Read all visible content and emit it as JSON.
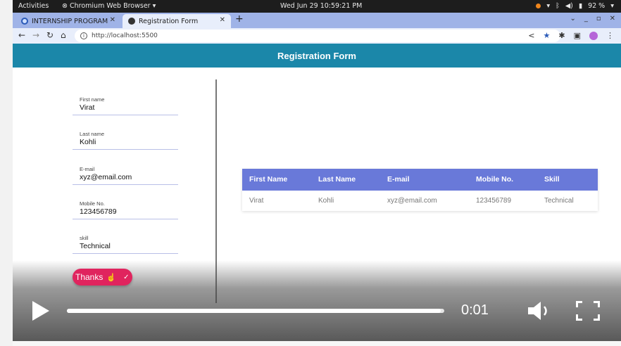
{
  "system_bar": {
    "activities": "Activities",
    "app": "Chromium Web Browser ▾",
    "clock": "Wed Jun 29  10:59:21 PM",
    "battery": "92 %"
  },
  "tabs": [
    {
      "label": "INTERNSHIP PROGRAM"
    },
    {
      "label": "Registration Form"
    }
  ],
  "omnibox": {
    "url": "http://localhost:5500"
  },
  "app": {
    "header": "Registration Form"
  },
  "form": {
    "fields": [
      {
        "label": "First name",
        "value": "Virat"
      },
      {
        "label": "Last name",
        "value": "Kohli"
      },
      {
        "label": "E-mail",
        "value": "xyz@email.com"
      },
      {
        "label": "Mobile No.",
        "value": "123456789"
      },
      {
        "label": "skill",
        "value": "Technical"
      }
    ],
    "submit_label": "Thanks"
  },
  "table": {
    "headers": [
      "First Name",
      "Last Name",
      "E-mail",
      "Mobile No.",
      "Skill"
    ],
    "rows": [
      [
        "Virat",
        "Kohli",
        "xyz@email.com",
        "123456789",
        "Technical"
      ]
    ]
  },
  "video": {
    "time": "0:01",
    "progress": 0.99
  },
  "colors": {
    "header": "#1b87a9",
    "table_header": "#6979d9",
    "button": "#e0245e"
  }
}
